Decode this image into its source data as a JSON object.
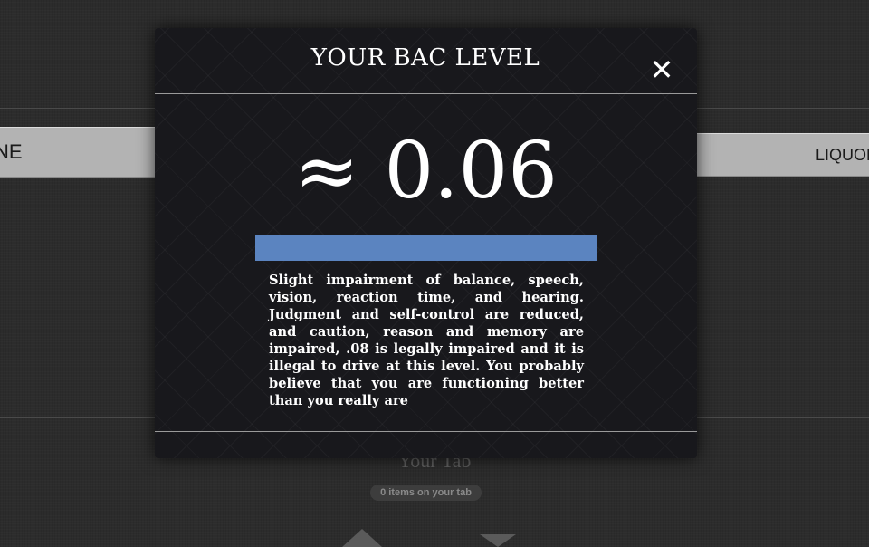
{
  "background": {
    "category_left": "NE",
    "category_right": "LIQUOR",
    "tab_title": "Your Tab",
    "tab_count": "0 items on your tab"
  },
  "modal": {
    "title": "YOUR BAC LEVEL",
    "close_icon": "close-icon",
    "bac_value": "≈ 0.06",
    "bac_bar_color": "#5b84c0",
    "description": "Slight impairment of balance, speech, vision, reaction time, and hearing. Judgment and self-control are reduced, and caution, reason and memory are impaired, .08 is legally impaired and it is illegal to drive at this level. You probably believe that you are functioning better than you really are"
  }
}
